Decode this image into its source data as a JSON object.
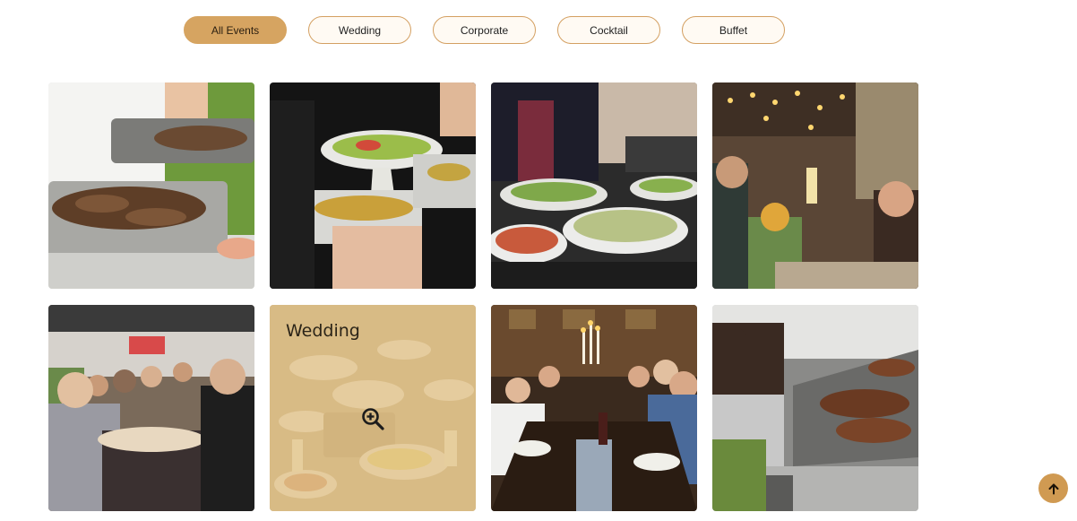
{
  "filters": [
    {
      "label": "All Events",
      "active": true
    },
    {
      "label": "Wedding",
      "active": false
    },
    {
      "label": "Corporate",
      "active": false
    },
    {
      "label": "Cocktail",
      "active": false
    },
    {
      "label": "Buffet",
      "active": false
    }
  ],
  "gallery": {
    "hover_overlay": {
      "title": "Wedding",
      "icon": "zoom-in-icon"
    }
  },
  "back_to_top": {
    "icon": "arrow-up-icon"
  },
  "colors": {
    "accent": "#d6a461",
    "pill_border": "#d4a062",
    "overlay": "#e2c48c",
    "back_to_top": "#d09a52"
  }
}
